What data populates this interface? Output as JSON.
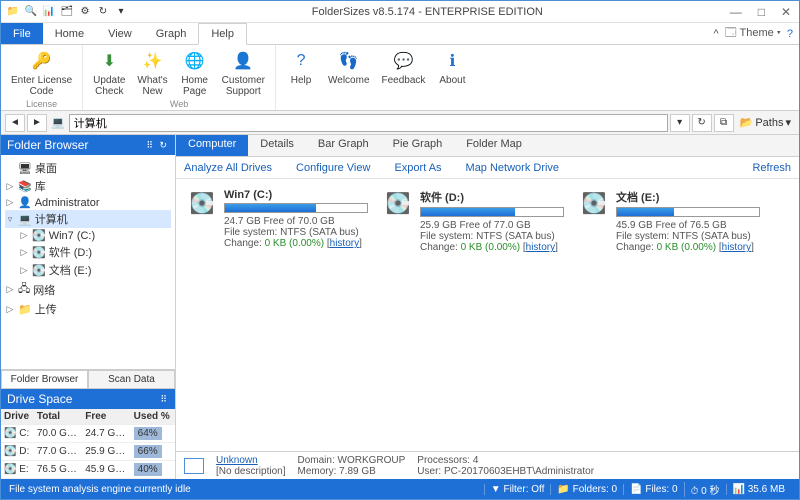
{
  "title": "FolderSizes v8.5.174 - ENTERPRISE EDITION",
  "menu": {
    "file": "File",
    "home": "Home",
    "view": "View",
    "graph": "Graph",
    "help": "Help",
    "theme": "Theme"
  },
  "ribbon": {
    "license": {
      "label": "Enter License\nCode",
      "group": "License"
    },
    "update": "Update\nCheck",
    "whatsnew": "What's\nNew",
    "homepage": "Home\nPage",
    "support": "Customer\nSupport",
    "webgroup": "Web",
    "help": "Help",
    "welcome": "Welcome",
    "feedback": "Feedback",
    "about": "About"
  },
  "nav": {
    "path": "计算机",
    "paths_label": "Paths"
  },
  "sidebar": {
    "header": "Folder Browser",
    "nodes": {
      "desktop": "桌面",
      "lib": "库",
      "admin": "Administrator",
      "computer": "计算机",
      "win7": "Win7 (C:)",
      "soft": "软件 (D:)",
      "docs": "文档 (E:)",
      "network": "网络",
      "upload": "上传"
    },
    "tabs": {
      "fb": "Folder Browser",
      "sd": "Scan Data"
    }
  },
  "drivespace": {
    "header": "Drive Space",
    "cols": {
      "drive": "Drive",
      "total": "Total",
      "free": "Free",
      "used": "Used %"
    },
    "rows": [
      {
        "drive": "C:",
        "total": "70.0 G…",
        "free": "24.7 G…",
        "used": "64%"
      },
      {
        "drive": "D:",
        "total": "77.0 G…",
        "free": "25.9 G…",
        "used": "66%"
      },
      {
        "drive": "E:",
        "total": "76.5 G…",
        "free": "45.9 G…",
        "used": "40%"
      }
    ]
  },
  "content": {
    "tabs": {
      "computer": "Computer",
      "details": "Details",
      "bar": "Bar Graph",
      "pie": "Pie Graph",
      "folder": "Folder Map"
    },
    "toolbar": {
      "analyze": "Analyze All Drives",
      "configure": "Configure View",
      "export": "Export As",
      "mapnet": "Map Network Drive",
      "refresh": "Refresh"
    },
    "drives": [
      {
        "name": "Win7 (C:)",
        "free": "24.7 GB Free of 70.0 GB",
        "fs": "File system: NTFS (SATA bus)",
        "change_label": "Change:",
        "change_val": "0 KB (0.00%)",
        "hist": "history",
        "used_pct": 64
      },
      {
        "name": "软件 (D:)",
        "free": "25.9 GB Free of 77.0 GB",
        "fs": "File system: NTFS (SATA bus)",
        "change_label": "Change:",
        "change_val": "0 KB (0.00%)",
        "hist": "history",
        "used_pct": 66
      },
      {
        "name": "文档 (E:)",
        "free": "45.9 GB Free of 76.5 GB",
        "fs": "File system: NTFS (SATA bus)",
        "change_label": "Change:",
        "change_val": "0 KB (0.00%)",
        "hist": "history",
        "used_pct": 40
      }
    ]
  },
  "footer": {
    "unknown": "Unknown",
    "nodesc": "[No description]",
    "domain": "Domain: WORKGROUP",
    "memory": "Memory: 7.89 GB",
    "procs": "Processors: 4",
    "user": "User: PC-20170603EHBT\\Administrator"
  },
  "status": {
    "msg": "File system analysis engine currently idle",
    "filter": "Filter: Off",
    "folders": "Folders: 0",
    "files": "Files: 0",
    "time": "0 秒",
    "mem": "35.6 MB"
  }
}
